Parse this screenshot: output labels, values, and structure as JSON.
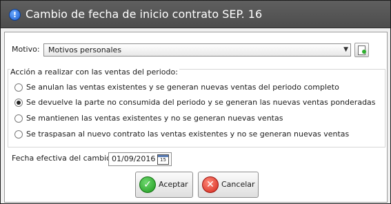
{
  "window": {
    "title": "Cambio de fecha de inicio contrato SEP. 16",
    "title_icon": "info-icon",
    "title_icon_glyph": "!"
  },
  "motivo": {
    "label": "Motivo:",
    "selected": "Motivos personales",
    "arrow_glyph": "▼",
    "side_button_icon": "document-icon"
  },
  "acciones": {
    "title": "Acción a realizar con las ventas del periodo:",
    "options": [
      {
        "label": "Se anulan las ventas existentes y se generan nuevas ventas del periodo completo",
        "checked": false
      },
      {
        "label": "Se devuelve la parte no consumida del periodo y se generan las nuevas ventas ponderadas",
        "checked": true
      },
      {
        "label": "Se mantienen las ventas existentes y no se generan nuevas ventas",
        "checked": false
      },
      {
        "label": "Se traspasan al nuevo contrato las ventas existentes y no se generan nuevas ventas",
        "checked": false
      }
    ]
  },
  "fecha": {
    "label": "Fecha efectiva del cambio",
    "value": "01/09/2016",
    "calendar_day": "15"
  },
  "buttons": {
    "accept_label": "Aceptar",
    "accept_glyph": "✓",
    "cancel_label": "Cancelar",
    "cancel_glyph": "✕"
  },
  "colors": {
    "titlebar": "#555555",
    "accept_icon": "#2fa52f",
    "cancel_icon": "#e0352a"
  }
}
